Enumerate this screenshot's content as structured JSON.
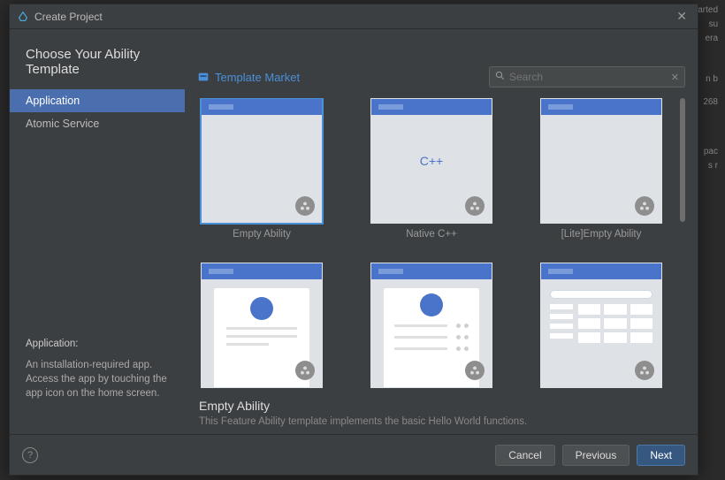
{
  "bg": {
    "sync": "Sync project started",
    "l2": "su",
    "l3": "era",
    "l4": "n b",
    "l5": "268",
    "l6": "pac",
    "l7": "s r"
  },
  "dialog": {
    "title": "Create Project"
  },
  "page_heading": "Choose Your Ability Template",
  "sidebar": {
    "items": [
      {
        "label": "Application"
      },
      {
        "label": "Atomic Service"
      }
    ],
    "desc_title": "Application:",
    "desc_body": "An installation-required app. Access the app by touching the app icon on the home screen."
  },
  "main": {
    "market_label": "Template Market",
    "search_placeholder": "Search"
  },
  "templates": [
    {
      "label": "Empty Ability",
      "kind": "empty"
    },
    {
      "label": "Native C++",
      "kind": "cpp"
    },
    {
      "label": "[Lite]Empty Ability",
      "kind": "empty"
    },
    {
      "label": "",
      "kind": "card"
    },
    {
      "label": "",
      "kind": "list"
    },
    {
      "label": "",
      "kind": "grid"
    }
  ],
  "selected_template": {
    "title": "Empty Ability",
    "desc": "This Feature Ability template implements the basic Hello World functions."
  },
  "footer": {
    "cancel": "Cancel",
    "previous": "Previous",
    "next": "Next"
  }
}
